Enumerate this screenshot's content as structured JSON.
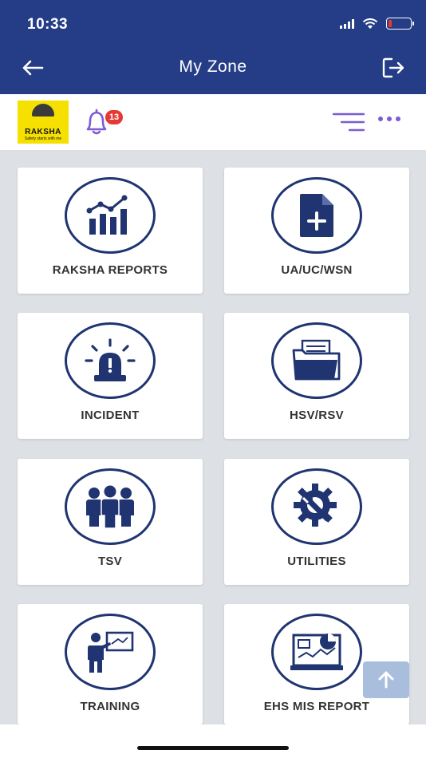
{
  "status_bar": {
    "time": "10:33",
    "battery_color": "#e53935"
  },
  "header": {
    "title": "My Zone",
    "bg_color": "#243d86",
    "back_icon": "arrow-left-icon",
    "logout_icon": "logout-icon"
  },
  "subheader": {
    "logo": {
      "name": "RAKSHA",
      "tagline": "Safety starts with me"
    },
    "notification_count": "13",
    "accent_color": "#7c5cd6"
  },
  "tiles": [
    {
      "label": "RAKSHA REPORTS",
      "icon": "bar-chart-icon"
    },
    {
      "label": "UA/UC/WSN",
      "icon": "file-add-icon"
    },
    {
      "label": "INCIDENT",
      "icon": "alarm-siren-icon"
    },
    {
      "label": "HSV/RSV",
      "icon": "folder-documents-icon"
    },
    {
      "label": "TSV",
      "icon": "team-icon"
    },
    {
      "label": "UTILITIES",
      "icon": "gear-wrench-icon"
    },
    {
      "label": "TRAINING",
      "icon": "presenter-board-icon"
    },
    {
      "label": "EHS MIS REPORT",
      "icon": "dashboard-monitor-icon"
    }
  ],
  "icon_color": "#1f3470"
}
